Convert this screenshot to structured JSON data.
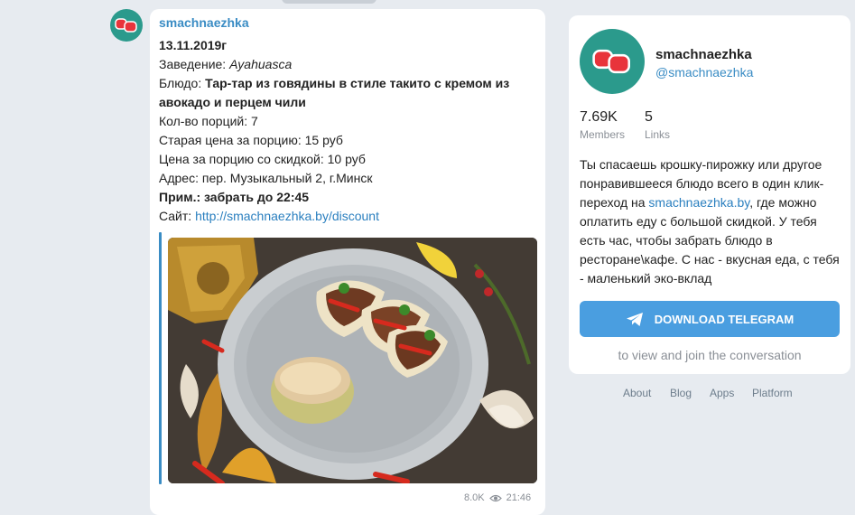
{
  "post": {
    "author": "smachnaezhka",
    "lines": {
      "date": "13.11.2019г",
      "venue_label": "Заведение: ",
      "venue_value": "Ayahuasca",
      "dish_label": "Блюдо: ",
      "dish_value_1": "Тар-тар из говядины в стиле такито с кремом из",
      "dish_value_2": "авокадо и перцем чили",
      "portions": "Кол-во порций: 7",
      "old_price": "Старая цена за порцию: 15 руб",
      "new_price": "Цена за порцию со скидкой: 10 руб",
      "address": "Адрес: пер. Музыкальный 2, г.Минск",
      "note_label": "Прим.: забрать до 22:45",
      "site_label": "Сайт: ",
      "site_url": "http://smachnaezhka.by/discount"
    },
    "views": "8.0K",
    "time": "21:46"
  },
  "channel": {
    "name": "smachnaezhka",
    "handle": "@smachnaezhka",
    "members_count": "7.69K",
    "members_label": "Members",
    "links_count": "5",
    "links_label": "Links",
    "desc_part1": "Ты спасаешь крошку-пирожку или другое понравившееся блюдо всего в один клик-переход на ",
    "desc_link": "smachnaezhka.by",
    "desc_part2": ", где можно оплатить еду с большой скидкой. У тебя есть час, чтобы забрать блюдо в ресторане\\кафе. С нас - вкусная еда, с тебя - маленький эко-вклад",
    "download_label": "DOWNLOAD TELEGRAM",
    "view_note": "to view and join the conversation"
  },
  "footer": {
    "about": "About",
    "blog": "Blog",
    "apps": "Apps",
    "platform": "Platform"
  },
  "colors": {
    "accent": "#3a8cc4",
    "button": "#4a9ee0",
    "avatar_bg": "#2b9a8c",
    "background": "#e7ebf0"
  },
  "icons": {
    "avatar": "smachnaezhka-logo-icon",
    "views": "eye-icon",
    "download": "telegram-plane-icon"
  }
}
